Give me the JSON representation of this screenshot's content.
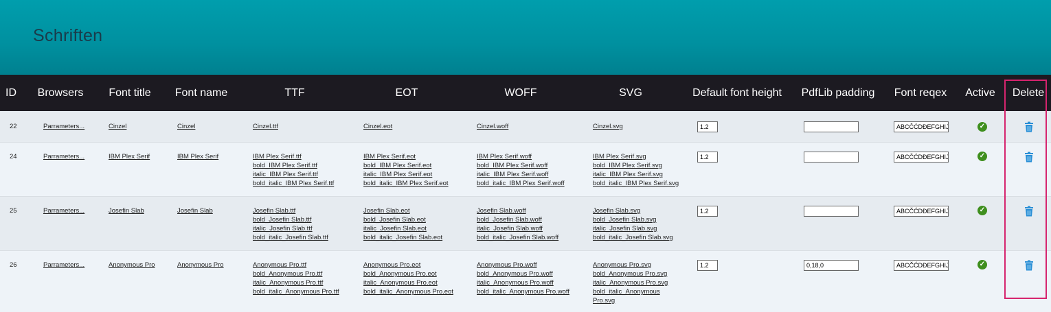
{
  "page": {
    "title": "Schriften"
  },
  "columns": [
    "ID",
    "Browsers",
    "Font title",
    "Font name",
    "TTF",
    "EOT",
    "WOFF",
    "SVG",
    "Default font height",
    "PdfLib padding",
    "Font reqex",
    "Active",
    "Delete"
  ],
  "rows": [
    {
      "id": "22",
      "browsers": "Parrameters...",
      "font_title": "Cinzel",
      "font_name": "Cinzel",
      "ttf": [
        "Cinzel.ttf"
      ],
      "eot": [
        "Cinzel.eot"
      ],
      "woff": [
        "Cinzel.woff"
      ],
      "svg": [
        "Cinzel.svg"
      ],
      "default_font_height": "1.2",
      "pdflib_padding": "",
      "font_regex": "ABCČĆDĐEFGHIJK"
    },
    {
      "id": "24",
      "browsers": "Parrameters...",
      "font_title": "IBM Plex Serif",
      "font_name": "IBM Plex Serif",
      "ttf": [
        "IBM Plex Serif.ttf",
        "bold_IBM Plex Serif.ttf",
        "italic_IBM Plex Serif.ttf",
        "bold_italic_IBM Plex Serif.ttf"
      ],
      "eot": [
        "IBM Plex Serif.eot",
        "bold_IBM Plex Serif.eot",
        "italic_IBM Plex Serif.eot",
        "bold_italic_IBM Plex Serif.eot"
      ],
      "woff": [
        "IBM Plex Serif.woff",
        "bold_IBM Plex Serif.woff",
        "italic_IBM Plex Serif.woff",
        "bold_italic_IBM Plex Serif.woff"
      ],
      "svg": [
        "IBM Plex Serif.svg",
        "bold_IBM Plex Serif.svg",
        "italic_IBM Plex Serif.svg",
        "bold_italic_IBM Plex Serif.svg"
      ],
      "default_font_height": "1.2",
      "pdflib_padding": "",
      "font_regex": "ABCČĆDĐEFGHIJK"
    },
    {
      "id": "25",
      "browsers": "Parrameters...",
      "font_title": "Josefin Slab",
      "font_name": "Josefin Slab",
      "ttf": [
        "Josefin Slab.ttf",
        "bold_Josefin Slab.ttf",
        "italic_Josefin Slab.ttf",
        "bold_italic_Josefin Slab.ttf"
      ],
      "eot": [
        "Josefin Slab.eot",
        "bold_Josefin Slab.eot",
        "italic_Josefin Slab.eot",
        "bold_italic_Josefin Slab.eot"
      ],
      "woff": [
        "Josefin Slab.woff",
        "bold_Josefin Slab.woff",
        "italic_Josefin Slab.woff",
        "bold_italic_Josefin Slab.woff"
      ],
      "svg": [
        "Josefin Slab.svg",
        "bold_Josefin Slab.svg",
        "italic_Josefin Slab.svg",
        "bold_italic_Josefin Slab.svg"
      ],
      "default_font_height": "1.2",
      "pdflib_padding": "",
      "font_regex": "ABCČĆDĐEFGHIJK"
    },
    {
      "id": "26",
      "browsers": "Parrameters...",
      "font_title": "Anonymous Pro",
      "font_name": "Anonymous Pro",
      "ttf": [
        "Anonymous Pro.ttf",
        "bold_Anonymous Pro.ttf",
        "italic_Anonymous Pro.ttf",
        "bold_italic_Anonymous Pro.ttf"
      ],
      "eot": [
        "Anonymous Pro.eot",
        "bold_Anonymous Pro.eot",
        "italic_Anonymous Pro.eot",
        "bold_italic_Anonymous Pro.eot"
      ],
      "woff": [
        "Anonymous Pro.woff",
        "bold_Anonymous Pro.woff",
        "italic_Anonymous Pro.woff",
        "bold_italic_Anonymous Pro.woff"
      ],
      "svg": [
        "Anonymous Pro.svg",
        "bold_Anonymous Pro.svg",
        "italic_Anonymous Pro.svg",
        "bold_italic_Anonymous Pro.svg"
      ],
      "default_font_height": "1.2",
      "pdflib_padding": "0,18,0",
      "font_regex": "ABCČĆDĐEFGHIJK"
    }
  ],
  "icons": {
    "active": "check-circle-icon",
    "delete": "trash-icon"
  },
  "colors": {
    "header_top": "#009ead",
    "table_header": "#1c1a21",
    "active": "#3f8f1e",
    "delete": "#2a8fd6",
    "highlight": "#d6246e"
  }
}
